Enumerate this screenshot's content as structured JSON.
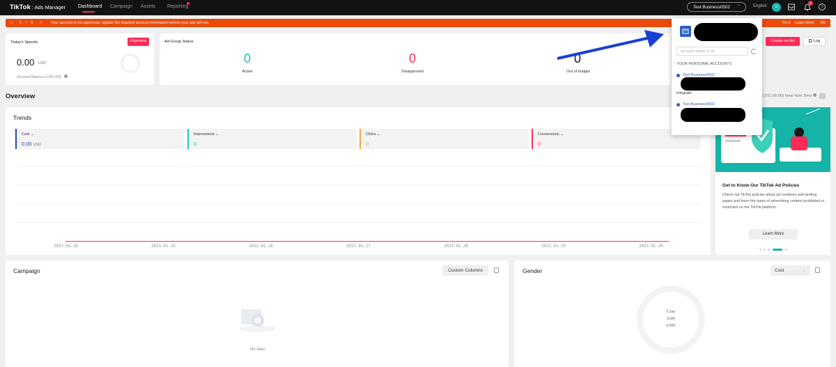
{
  "nav": {
    "logo": "TikTok",
    "logo_sub": ": Ads Manager",
    "items": [
      "Dashboard",
      "Campaign",
      "Assets",
      "Reporting"
    ],
    "account": "Test Business0502",
    "language": "English",
    "avatar_initial": "u",
    "bell_count": "1"
  },
  "banner": {
    "current": "1",
    "sep": "/",
    "total": "4",
    "message": "Your account is not approved. Update the required account information before your ads will run.",
    "fix": "Fix it",
    "learn": "Learn More",
    "ok": "OK",
    "color": "#ea4b0b"
  },
  "spends": {
    "title": "Today's Spends",
    "payment": "Payment",
    "amount": "0.00",
    "unit": "USD",
    "balance": "Account Balance 0.00 USD"
  },
  "ad_group_status": {
    "title": "Ad Group Status",
    "items": [
      {
        "value": "0",
        "label": "Active",
        "color": "#20c4b7"
      },
      {
        "value": "0",
        "label": "Disapproved",
        "color": "#fe2c55"
      },
      {
        "value": "0",
        "label": "Out of budget",
        "color": "#161823"
      }
    ]
  },
  "actions": {
    "create": "Create an Ad",
    "log": "Log"
  },
  "overview": {
    "title": "Overview",
    "timezone": "(UTC-05:00) New York Time"
  },
  "trends": {
    "title": "Trends",
    "metrics": [
      {
        "name": "Cost",
        "value": "0.00",
        "unit": "USD",
        "color": "#2849ad"
      },
      {
        "name": "Impressions",
        "value": "0",
        "unit": "",
        "color": "#20c4b7"
      },
      {
        "name": "Clicks",
        "value": "0",
        "unit": "",
        "color": "#f0a640"
      },
      {
        "name": "Conversions",
        "value": "0",
        "unit": "",
        "color": "#fe2c55"
      }
    ],
    "dates": [
      "2023-01-24",
      "2023-01-25",
      "2023-01-26",
      "2023-01-27",
      "2023-01-28",
      "2023-01-29",
      "2023-01-30"
    ]
  },
  "promo": {
    "title": "Get to Know Our TikTok Ad Policies",
    "text": "Check out TikTok policies about ad creatives and landing pages and learn the types of advertising content prohibited or restricted on the TikTok platform.",
    "button": "Learn More"
  },
  "campaign": {
    "title": "Campaign",
    "custom_columns": "Custom Columns",
    "no_data": "No data"
  },
  "gender": {
    "title": "Gender",
    "select": "Cost",
    "center_label": "Cost",
    "center_value": "0.00",
    "center_unit": "USD"
  },
  "dropdown": {
    "search_placeholder": "Account name or ID",
    "section": "YOUR PERSONAL ACCOUNTS",
    "accounts": [
      "Test Business0502",
      "Test Business0502"
    ],
    "integrate": "Integrate"
  }
}
